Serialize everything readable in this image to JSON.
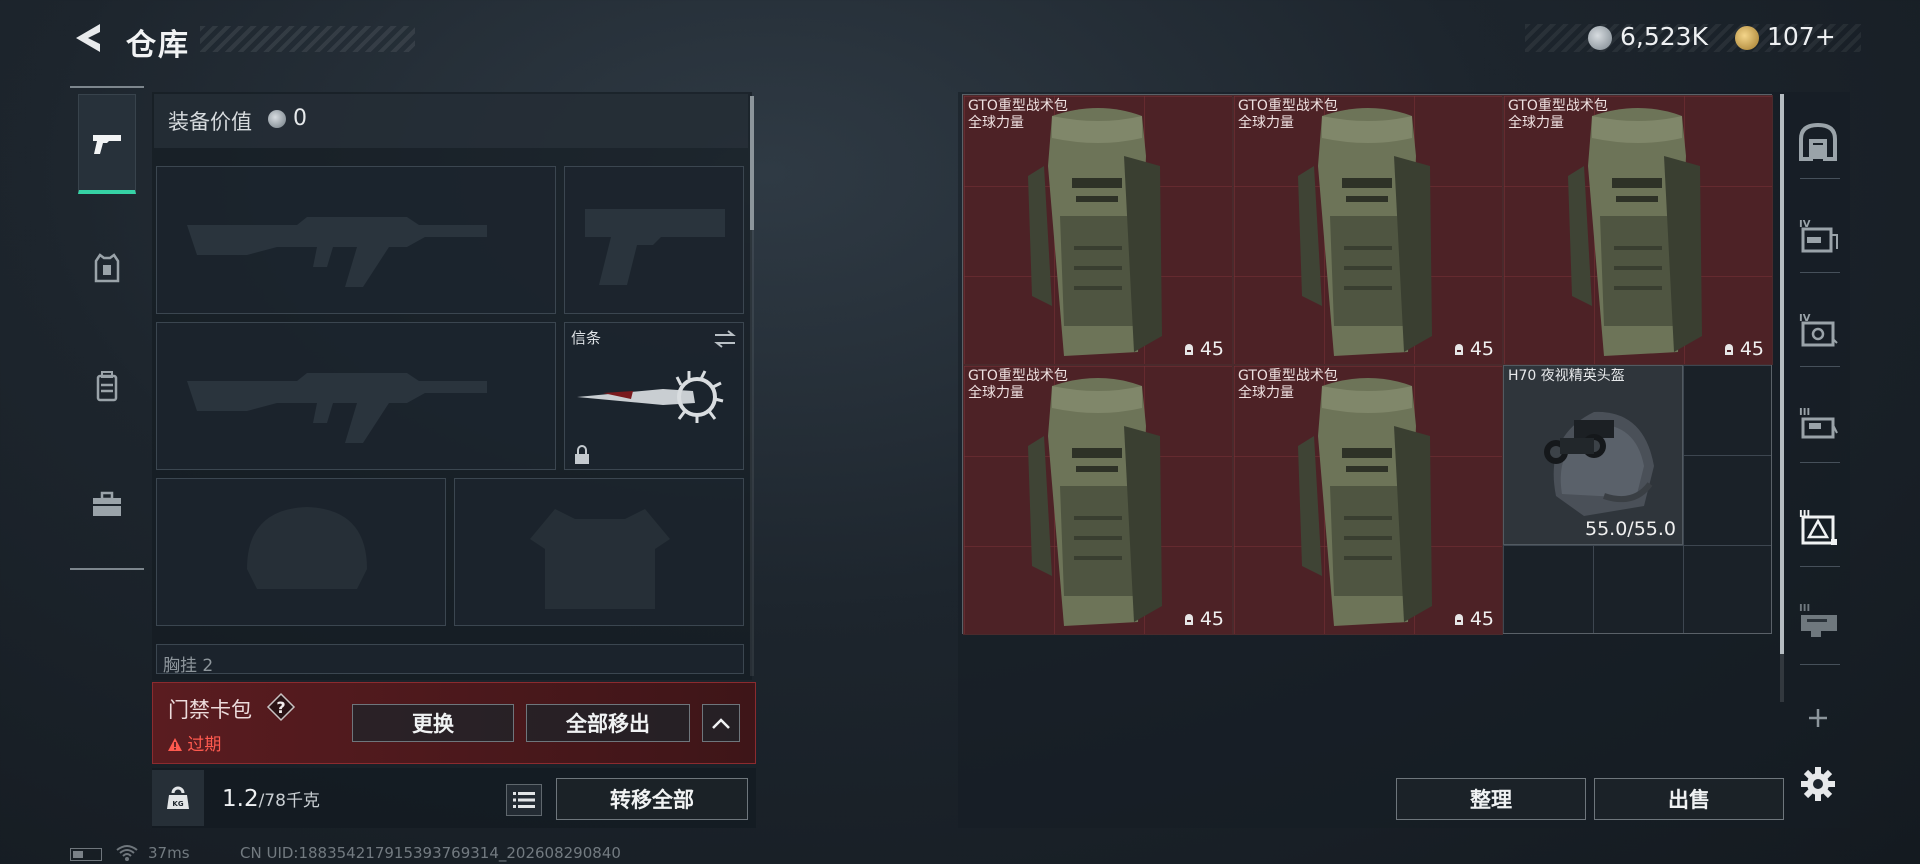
{
  "header": {
    "title": "仓库"
  },
  "currency": {
    "silver": "6,523K",
    "gold": "107+"
  },
  "tabs": [
    "weapon-tab",
    "armor-tab",
    "backpack-tab",
    "toolbox-tab"
  ],
  "equipment": {
    "value_label": "装备价值",
    "value": "0",
    "slots": {
      "melee_label": "信条",
      "chest_rig_label": "胸挂",
      "chest_rig_count": "2"
    }
  },
  "access_card": {
    "title": "门禁卡包",
    "status": "过期",
    "replace_label": "更换",
    "remove_all_label": "全部移出"
  },
  "weight": {
    "current": "1.2",
    "max": "/78千克",
    "transfer_all_label": "转移全部"
  },
  "status_bar": {
    "ping": "37ms",
    "uid": "CN UID:1883542179153937693​14_202608290840"
  },
  "storage": {
    "items": [
      {
        "name": "GTO重型战术包",
        "sub": "全球力量",
        "qty": "45"
      },
      {
        "name": "GTO重型战术包",
        "sub": "全球力量",
        "qty": "45"
      },
      {
        "name": "GTO重型战术包",
        "sub": "全球力量",
        "qty": "45"
      },
      {
        "name": "GTO重型战术包",
        "sub": "全球力量",
        "qty": "45"
      },
      {
        "name": "GTO重型战术包",
        "sub": "全球力量",
        "qty": "45"
      },
      {
        "name": "H70 夜视精英头盔",
        "durability": "55.0/55.0"
      }
    ],
    "sort_label": "整理",
    "sell_label": "出售"
  },
  "sidebar_icons": [
    "shelter-icon",
    "tier-iv-case-icon",
    "tier-iv-safe-icon",
    "tier-iii-box-icon",
    "tier-iii-warning-box-icon",
    "tier-iii-crate-icon",
    "plus-icon",
    "gear-icon"
  ],
  "colors": {
    "accent": "#36d2a5",
    "item_bg": "#4d2226",
    "expired": "#ff5a4f"
  }
}
